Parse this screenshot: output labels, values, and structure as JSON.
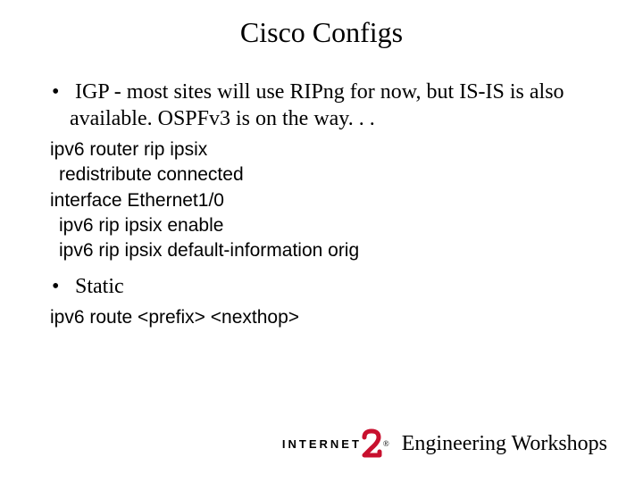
{
  "title": "Cisco Configs",
  "bullets": [
    "IGP - most sites will use RIPng for now, but IS-IS is also available. OSPFv3 is on the way. . .",
    "Static"
  ],
  "code1": {
    "l1": "ipv6 router rip ipsix",
    "l2": "redistribute connected",
    "l3": "interface Ethernet1/0",
    "l4": "ipv6 rip ipsix enable",
    "l5": "ipv6 rip ipsix default-information orig"
  },
  "code2": {
    "l1": "ipv6 route <prefix> <nexthop>"
  },
  "footer": {
    "logo_left": "INTERNET",
    "logo_reg": "®",
    "text": "Engineering Workshops"
  }
}
